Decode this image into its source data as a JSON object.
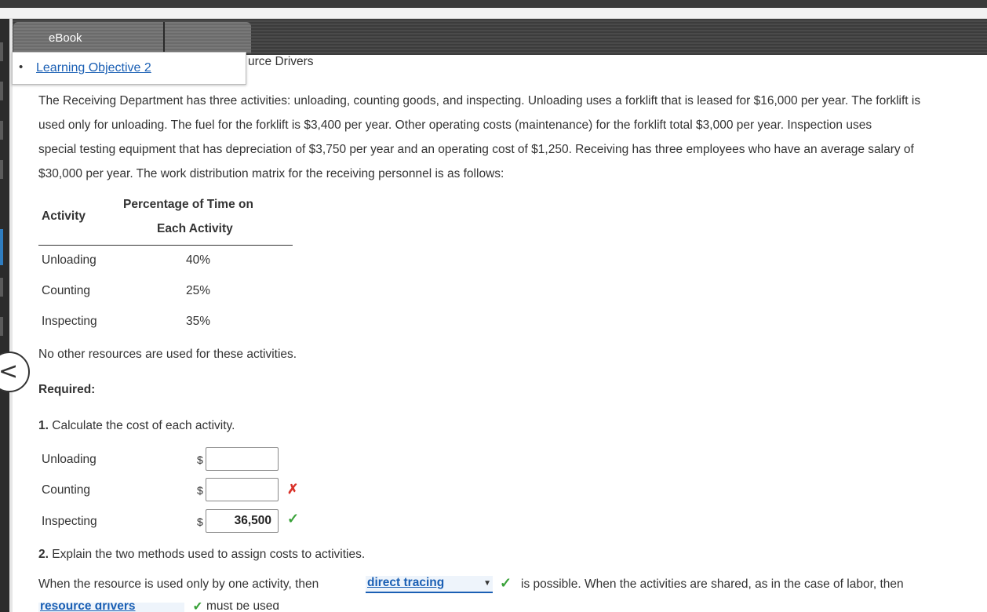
{
  "tabs": {
    "ebook": "eBook"
  },
  "menu": {
    "learning_objective": "Learning Objective 2"
  },
  "section_title": "urce Drivers",
  "problem": {
    "lines": [
      "The Receiving Department has three activities: unloading, counting goods, and inspecting. Unloading uses a forklift that is leased for $16,000 per year. The forklift is",
      "used only for unloading. The fuel for the forklift is $3,400 per year. Other operating costs (maintenance) for the forklift total $3,000 per year. Inspection uses",
      "special testing equipment that has depreciation of $3,750 per year and an operating cost of $1,250. Receiving has three employees who have an average salary of",
      "$30,000 per year. The work distribution matrix for the receiving personnel is as follows:"
    ]
  },
  "matrix": {
    "header_activity": "Activity",
    "header_pct_line1": "Percentage of Time on",
    "header_pct_line2": "Each Activity",
    "rows": [
      {
        "activity": "Unloading",
        "pct": "40%"
      },
      {
        "activity": "Counting",
        "pct": "25%"
      },
      {
        "activity": "Inspecting",
        "pct": "35%"
      }
    ]
  },
  "note": "No other resources are used for these activities.",
  "required_label": "Required:",
  "q1": {
    "number": "1.",
    "text": "Calculate the cost of each activity."
  },
  "costs": [
    {
      "label": "Unloading",
      "currency": "$",
      "value": "",
      "status": "none"
    },
    {
      "label": "Counting",
      "currency": "$",
      "value": "",
      "status": "incorrect"
    },
    {
      "label": "Inspecting",
      "currency": "$",
      "value": "36,500",
      "status": "correct"
    }
  ],
  "q2": {
    "number": "2.",
    "text": "Explain the two methods used to assign costs to activities."
  },
  "explanation": {
    "before": "When the resource is used only by one activity, then",
    "select1": "direct tracing",
    "after": "is possible. When the activities are shared, as in the case of labor, then",
    "select2": "resource drivers",
    "tail": "must be used"
  },
  "icons": {
    "correct": "check-icon",
    "incorrect": "x-icon",
    "back": "chevron-left-icon"
  },
  "colors": {
    "link": "#1a5fb4",
    "correct": "#3aa23a",
    "incorrect": "#d9322a"
  }
}
